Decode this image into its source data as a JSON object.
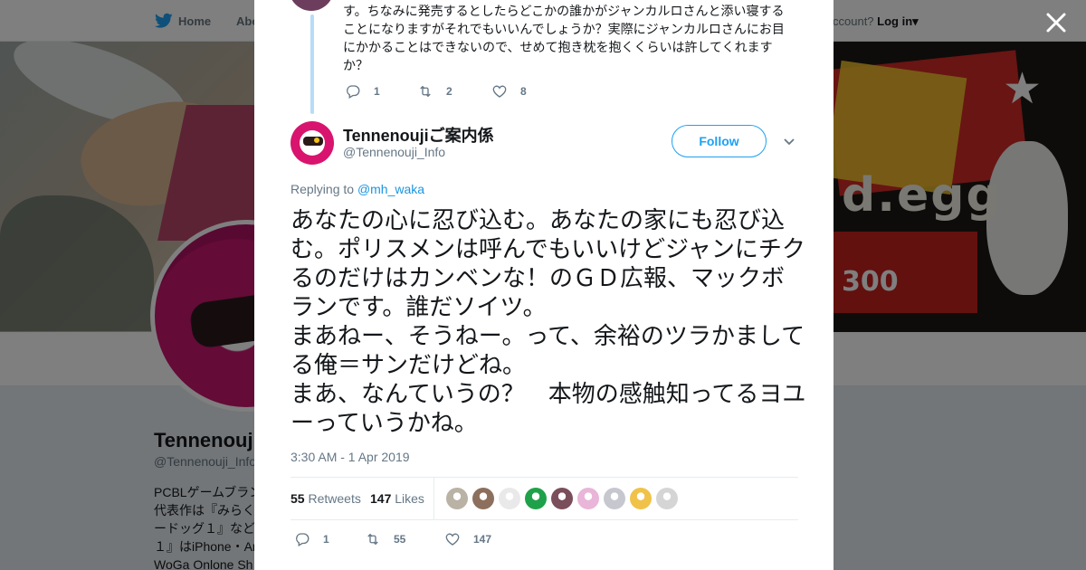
{
  "topnav": {
    "home_label": "Home",
    "about_label": "Abo",
    "account_prompt": "ccount?",
    "login_label": "Log in"
  },
  "profile": {
    "name": "Tennenouji",
    "handle": "@Tennenouji_Info",
    "bio_lines": [
      "PCBLゲームブラン",
      "代表作は『みらく",
      "ードッグ１』など",
      "１』はiPhone・An",
      "WoGa Onlone Sh"
    ]
  },
  "parent_tweet": {
    "text": "す。ちなみに発売するとしたらどこかの誰かがジャンカルロさんと添い寝することになりますがそれでもいいんでしょうか？実際にジャンカルロさんにお目にかかることはできないので、せめて抱き枕を抱くくらいは許してくれますか？",
    "replies": "1",
    "retweets": "2",
    "likes": "8"
  },
  "tweet": {
    "author_name": "Tennenoujiご案内係",
    "author_handle": "@Tennenouji_Info",
    "follow_label": "Follow",
    "replying_prefix": "Replying to",
    "replying_to": "@mh_waka",
    "text": "あなたの心に忍び込む。あなたの家にも忍び込む。ポリスメンは呼んでもいいけどジャンにチクるのだけはカンベンな！のＧＤ広報、マックボランです。誰だソイツ。\nまあねー、そうねー。って、余裕のツラかましてる俺＝サンだけどね。\nまあ、なんていうの？　本物の感触知ってるヨユーっていうかね。",
    "timestamp": "3:30 AM - 1 Apr 2019",
    "retweet_count": "55",
    "retweet_label": "Retweets",
    "like_count": "147",
    "like_label": "Likes",
    "reply_count": "1",
    "footer_retweets": "55",
    "footer_likes": "147"
  },
  "likers": [
    "#b9b2a5",
    "#8c6f5c",
    "#e9e9ea",
    "#1fa14a",
    "#7a4e5a",
    "#e9b5d9",
    "#c7c7d0",
    "#f0c24a",
    "#d5d5d5"
  ],
  "colors": {
    "accent": "#1da1f2",
    "thread_line": "#b7dcf6",
    "text_primary": "#14171a",
    "text_secondary": "#657786"
  }
}
